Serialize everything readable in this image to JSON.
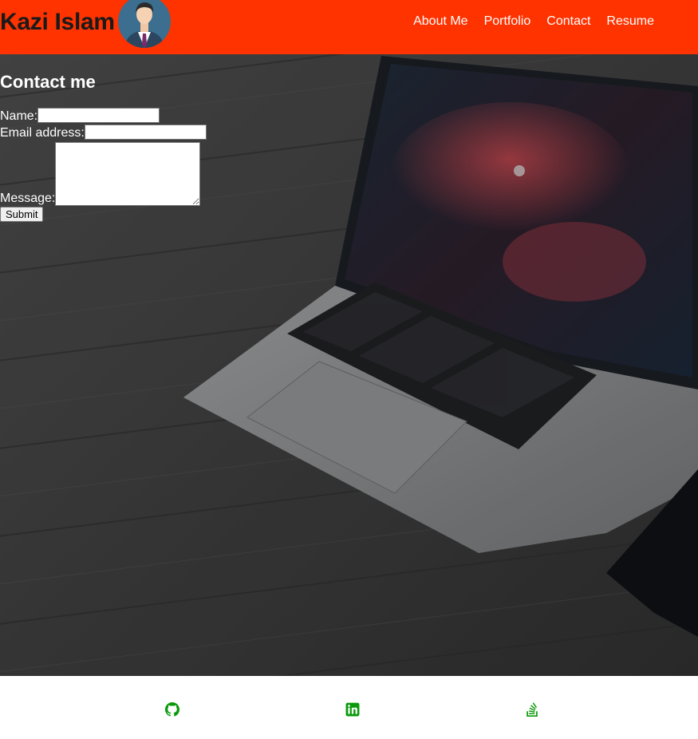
{
  "header": {
    "brand": "Kazi Islam",
    "nav": [
      "About Me",
      "Portfolio",
      "Contact",
      "Resume"
    ],
    "background_color": "#ff3300"
  },
  "contact": {
    "title": "Contact me",
    "name_label": "Name:",
    "email_label": "Email address:",
    "message_label": "Message:",
    "submit_label": "Submit"
  },
  "footer": {
    "icons": [
      "github-icon",
      "linkedin-icon",
      "stackoverflow-icon"
    ],
    "icon_color": "#0a9a0a"
  }
}
